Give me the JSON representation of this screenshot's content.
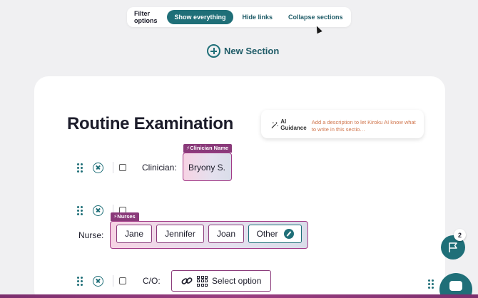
{
  "filter_bar": {
    "label": "Filter options",
    "buttons": [
      {
        "label": "Show everything",
        "active": true
      },
      {
        "label": "Hide links",
        "active": false
      },
      {
        "label": "Collapse sections",
        "active": false
      }
    ]
  },
  "new_section": {
    "label": "New Section"
  },
  "section": {
    "title": "Routine Examination",
    "ai_guidance": {
      "label": "AI Guidance",
      "description": "Add a description to let Kiroku AI know what to write in this sectio…"
    }
  },
  "fields": {
    "clinician": {
      "label": "Clinician:",
      "tag": "Clinician Name",
      "value": "Bryony S."
    },
    "nurse": {
      "label": "Nurse:",
      "tag": "Nurses",
      "options": [
        "Jane",
        "Jennifer",
        "Joan",
        "Other"
      ]
    },
    "co": {
      "label": "C/O:",
      "placeholder": "Select option"
    }
  },
  "notifications": {
    "count": "2"
  },
  "colors": {
    "accent": "#1f6f78",
    "tag": "#8a3a7a",
    "guidance_text": "#d0744b"
  }
}
